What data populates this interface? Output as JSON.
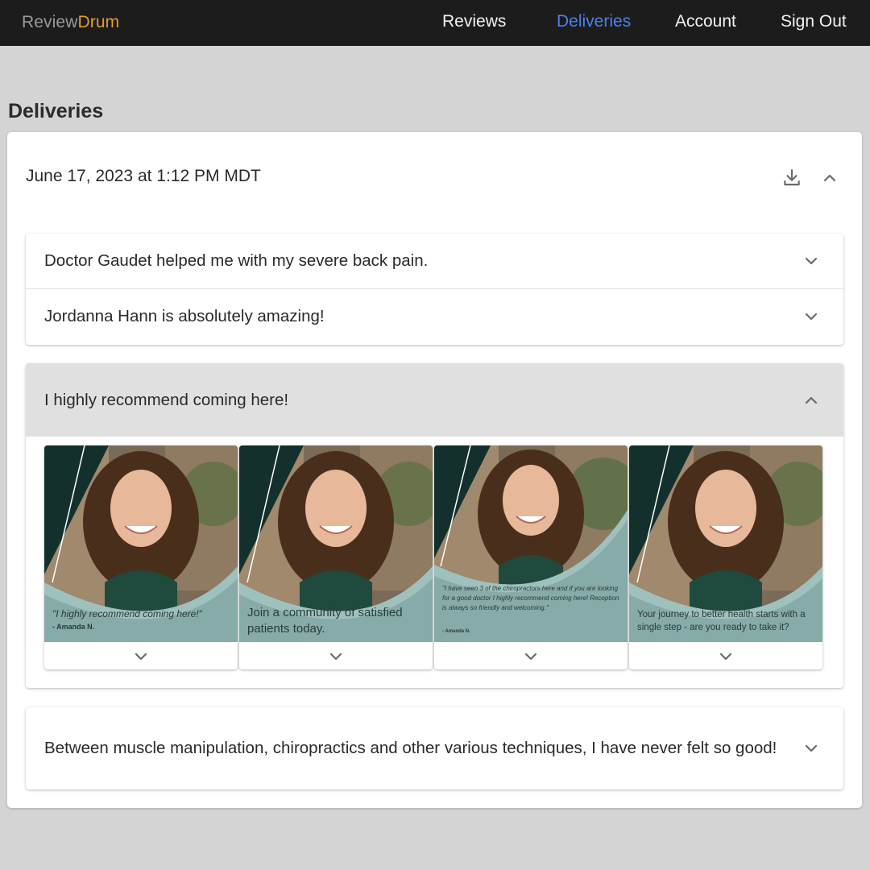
{
  "brand": {
    "part1": "Review",
    "part2": "Drum"
  },
  "nav": [
    {
      "label": "Reviews"
    },
    {
      "label": "Deliveries"
    },
    {
      "label": "Account"
    },
    {
      "label": "Sign Out"
    }
  ],
  "page": {
    "title": "Deliveries"
  },
  "delivery": {
    "date": "June 17, 2023 at 1:12 PM MDT",
    "icons": [
      "download-icon",
      "chevron-up-icon"
    ],
    "reviews": [
      {
        "text": "Doctor Gaudet helped me with my severe back pain."
      },
      {
        "text": "Jordanna Hann is absolutely amazing!"
      },
      {
        "text": "I highly recommend coming here!"
      },
      {
        "text": "Between muscle manipulation, chiropractics and other various techniques, I have never felt so good!"
      }
    ],
    "graphics": [
      {
        "caption": "\"I highly recommend coming here!\"",
        "author": "- Amanda N."
      },
      {
        "caption": "Join a community of satisfied patients today.",
        "author": ""
      },
      {
        "caption": "\"I have seen 3 of the chiropractors here and if you are looking for a good doctor I highly recommend coming here! Reception is always so friendly and welcoming.\"",
        "author": "- Amanda N."
      },
      {
        "caption": "Your journey to better health starts with a single step - are you ready to take it?",
        "author": ""
      }
    ]
  },
  "colors": {
    "topbar": "#1c1c1c",
    "accent": "#4f7ff0",
    "brand_orange": "#e59a2f",
    "background": "#d4d4d4",
    "teal": "#86aba8",
    "dark_teal": "#13302c"
  }
}
